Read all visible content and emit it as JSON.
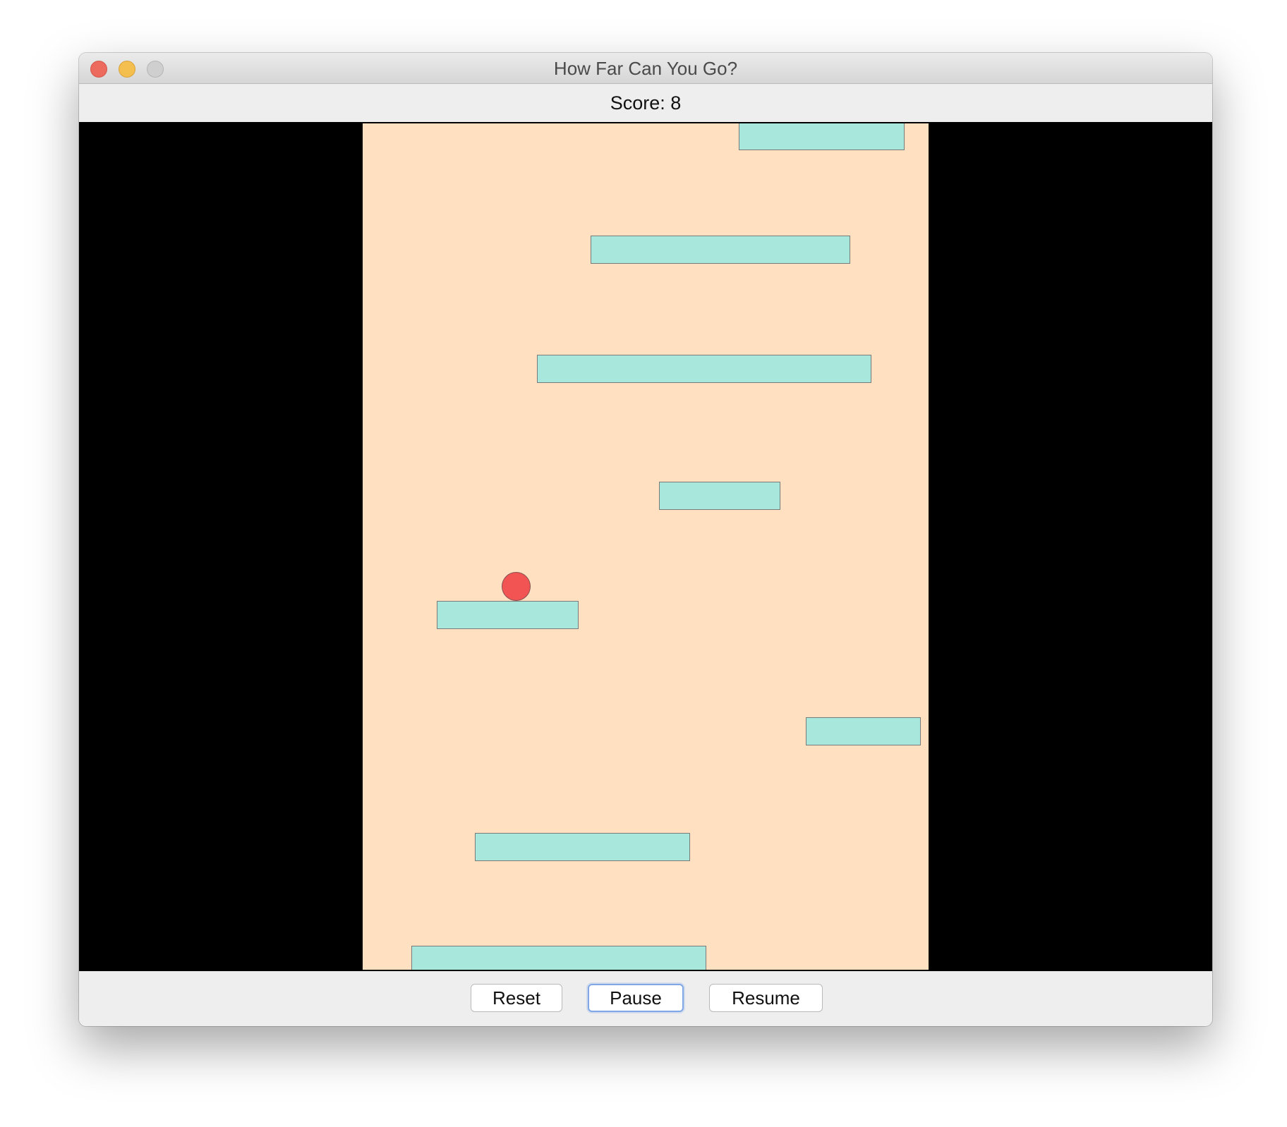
{
  "window": {
    "title": "How Far Can You Go?"
  },
  "score": {
    "label": "Score: 8",
    "value": 8
  },
  "colors": {
    "playfield": "#ffe0c1",
    "platform": "#a8e7dc",
    "ball": "#f25353",
    "side_background": "#000000"
  },
  "controls": {
    "reset_label": "Reset",
    "pause_label": "Pause",
    "resume_label": "Resume",
    "focused_button": "Pause"
  }
}
